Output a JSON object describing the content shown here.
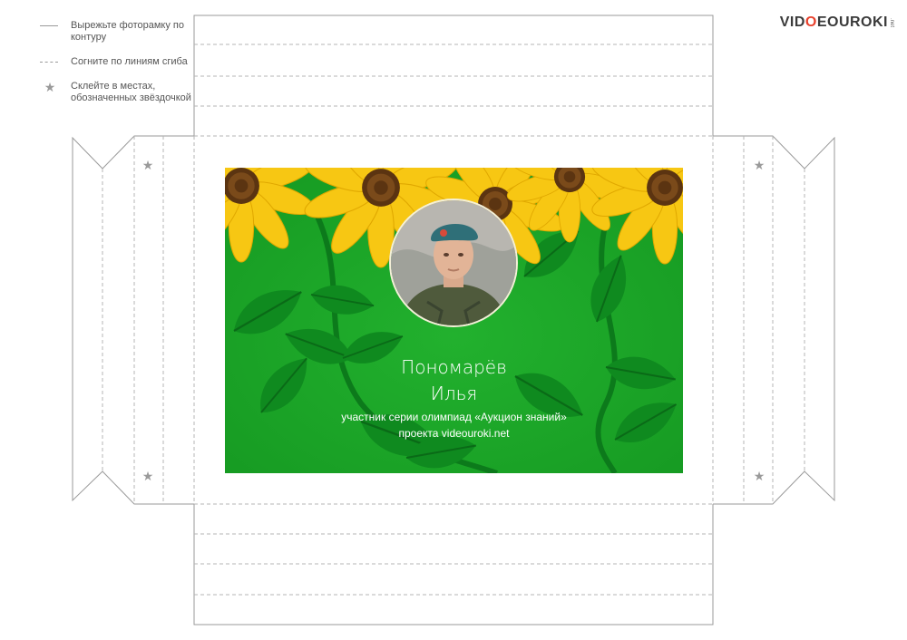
{
  "legend": {
    "items": [
      {
        "icon": "solid-line",
        "text": "Вырежьте фоторамку по контуру"
      },
      {
        "icon": "dashed-line",
        "text": "Согните по линиям сгиба"
      },
      {
        "icon": "star-icon",
        "text": "Склейте в местах, обозначенных звёздочкой"
      }
    ]
  },
  "logo": {
    "main": "VIDEOUROKI",
    "accent_letter": "O",
    "suffix": ".net"
  },
  "card": {
    "name_line1": "Пономарёв",
    "name_line2": "Илья",
    "caption_line1": "участник серии олимпиад «Аукцион знаний»",
    "caption_line2": "проекта videouroki.net"
  },
  "colors": {
    "cut_line": "#9a9a9a",
    "star": "#9a9a9a",
    "card_green": "#1fa82a",
    "leaf_dark": "#0f7e1e",
    "petal_yellow": "#f7c713",
    "flower_center": "#5b3411",
    "logo_accent": "#e8412c"
  }
}
